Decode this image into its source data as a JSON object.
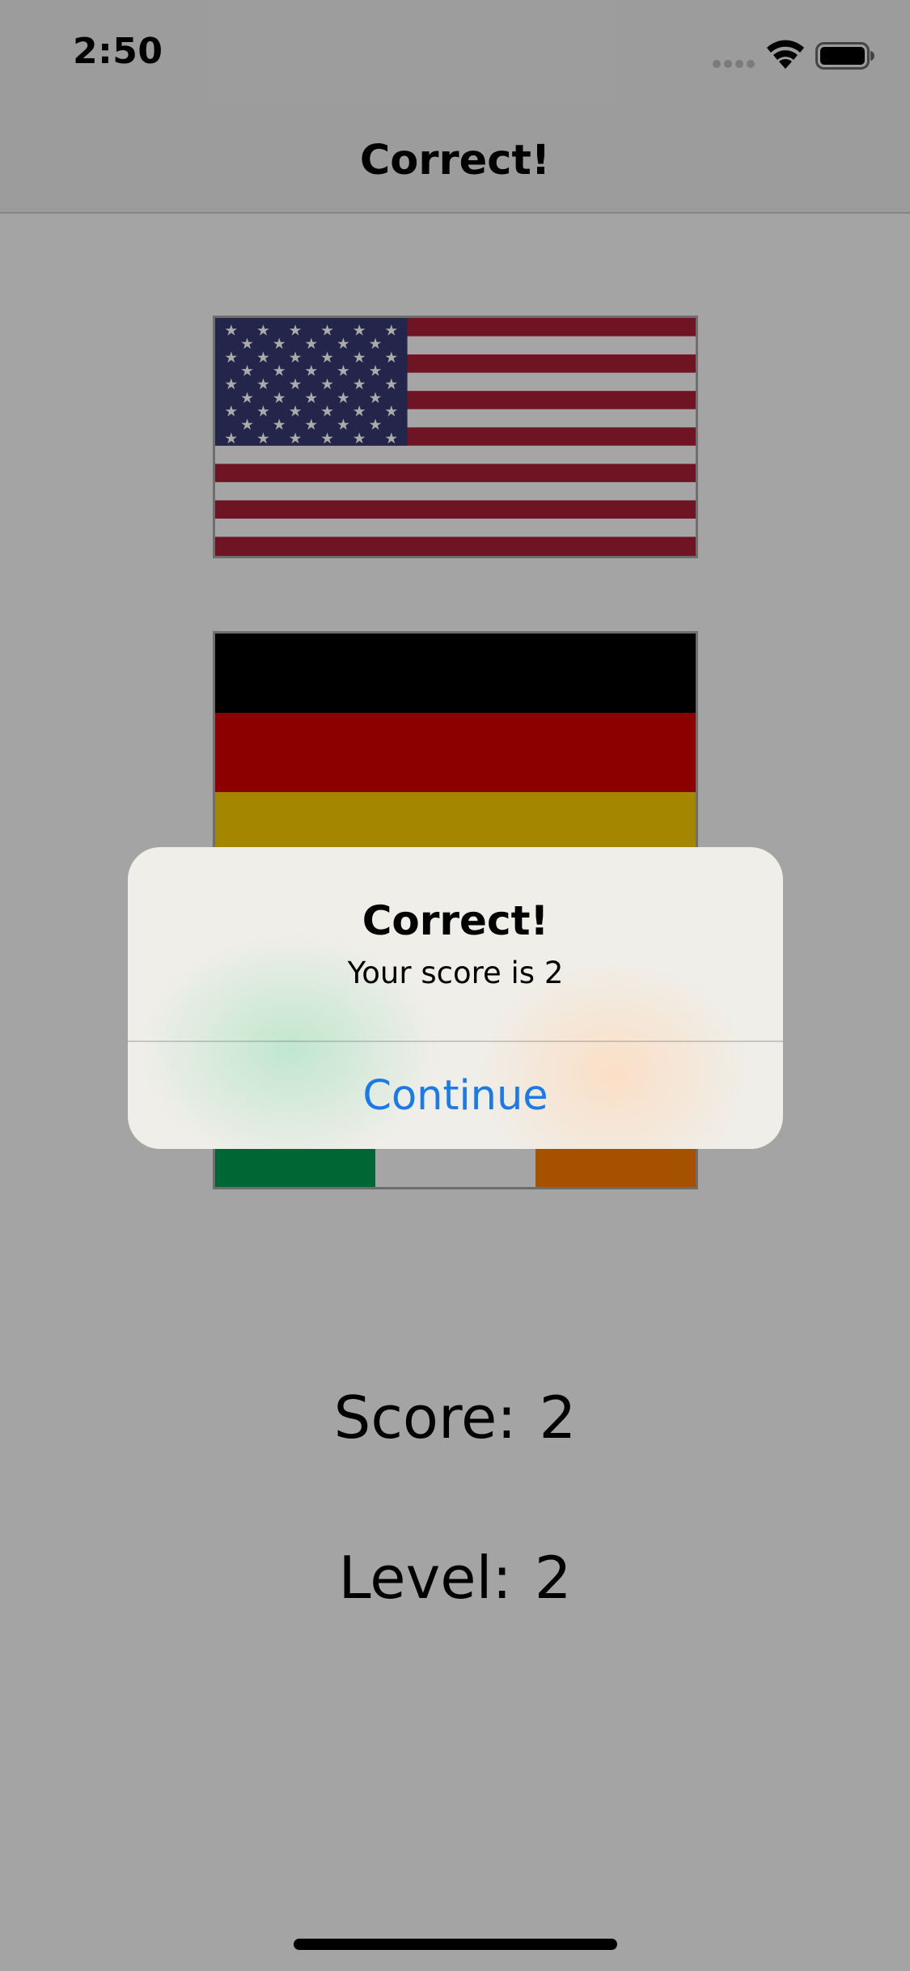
{
  "status_bar": {
    "time": "2:50",
    "icons": [
      "signal-dots-icon",
      "wifi-icon",
      "battery-icon"
    ]
  },
  "nav": {
    "title": "Correct!"
  },
  "flags": [
    {
      "country": "United States",
      "icon": "us-flag-icon"
    },
    {
      "country": "Germany",
      "icon": "germany-flag-icon"
    },
    {
      "country": "Ireland",
      "icon": "ireland-flag-icon"
    }
  ],
  "stats": {
    "score_label": "Score:",
    "score_value": "2",
    "level_label": "Level:",
    "level_value": "2"
  },
  "alert": {
    "title": "Correct!",
    "message": "Your score is 2",
    "button_label": "Continue"
  },
  "colors": {
    "background": "#cdcdcd",
    "bar_background": "#c4c4c4",
    "alert_button": "#1a7ae8",
    "us_red": "#8b1a2b",
    "us_blue": "#2e2f5e",
    "de_black": "#000000",
    "de_red": "#b00000",
    "de_gold": "#cfa800",
    "ie_green": "#008040",
    "ie_orange": "#d06600"
  }
}
